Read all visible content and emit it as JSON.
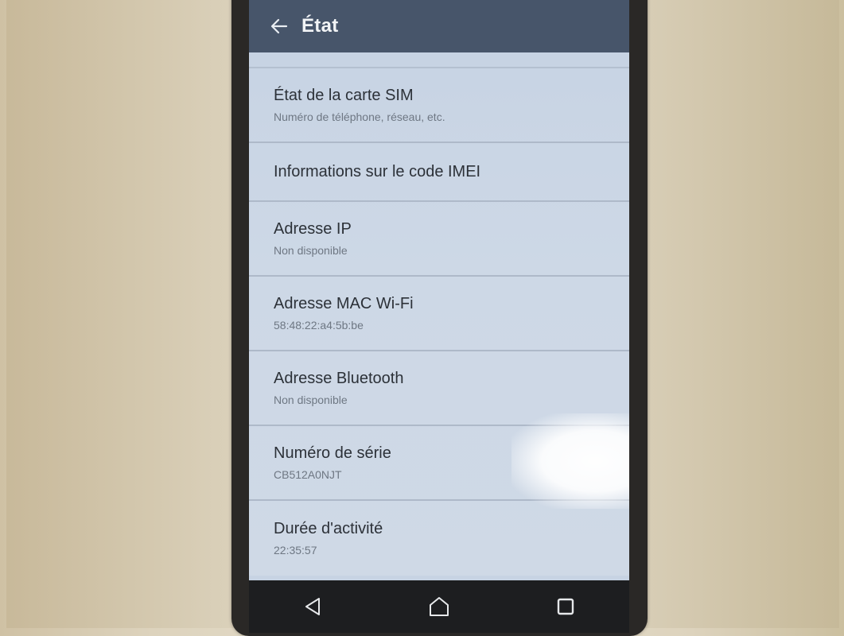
{
  "app_bar": {
    "title": "État",
    "back_icon": "arrow-left-icon"
  },
  "rows": [
    {
      "title": "État de la carte SIM",
      "subtitle": "Numéro de téléphone, réseau, etc."
    },
    {
      "title": "Informations sur le code IMEI",
      "subtitle": ""
    },
    {
      "title": "Adresse IP",
      "subtitle": "Non disponible"
    },
    {
      "title": "Adresse MAC Wi-Fi",
      "subtitle": "58:48:22:a4:5b:be"
    },
    {
      "title": "Adresse Bluetooth",
      "subtitle": "Non disponible"
    },
    {
      "title": "Numéro de série",
      "subtitle": "CB512A0NJT"
    },
    {
      "title": "Durée d'activité",
      "subtitle": "22:35:57"
    }
  ],
  "nav_bar": {
    "back_icon": "triangle-back-icon",
    "home_icon": "home-icon",
    "recents_icon": "recents-square-icon"
  },
  "colors": {
    "app_bar": "#47556a",
    "screen_bg": "#c7d3e3",
    "nav_bar": "#1d1e20"
  }
}
